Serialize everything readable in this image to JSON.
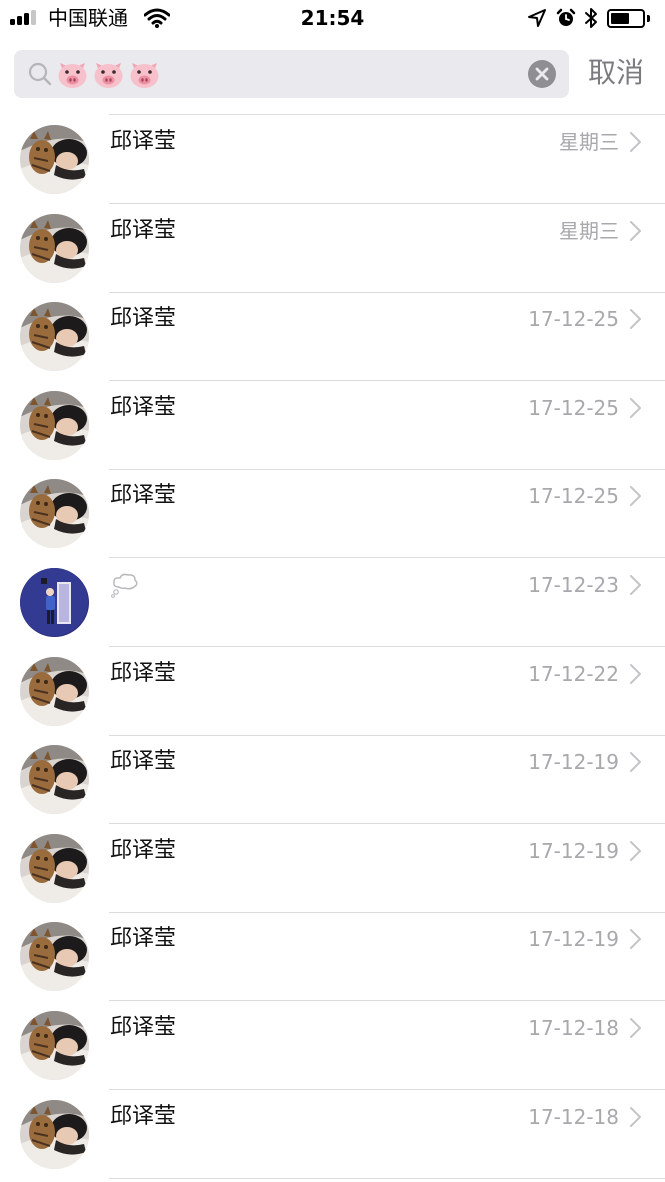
{
  "status_bar": {
    "carrier": "中国联通",
    "time": "21:54",
    "icons": [
      "signal-icon",
      "wifi-icon",
      "location-arrow-icon",
      "alarm-icon",
      "bluetooth-icon",
      "battery-icon"
    ]
  },
  "search": {
    "query_icons": [
      "pig-face-icon",
      "pig-face-icon",
      "pig-face-icon"
    ],
    "clear_icon": "clear-icon",
    "cancel_label": "取消"
  },
  "results": [
    {
      "name": "邱译莹",
      "date": "星期三",
      "avatar": "photo-avatar"
    },
    {
      "name": "邱译莹",
      "date": "星期三",
      "avatar": "photo-avatar"
    },
    {
      "name": "邱译莹",
      "date": "17-12-25",
      "avatar": "photo-avatar"
    },
    {
      "name": "邱译莹",
      "date": "17-12-25",
      "avatar": "photo-avatar"
    },
    {
      "name": "邱译莹",
      "date": "17-12-25",
      "avatar": "photo-avatar"
    },
    {
      "name": "",
      "name_icon": "thought-bubble-icon",
      "date": "17-12-23",
      "avatar": "illustration-avatar"
    },
    {
      "name": "邱译莹",
      "date": "17-12-22",
      "avatar": "photo-avatar"
    },
    {
      "name": "邱译莹",
      "date": "17-12-19",
      "avatar": "photo-avatar"
    },
    {
      "name": "邱译莹",
      "date": "17-12-19",
      "avatar": "photo-avatar"
    },
    {
      "name": "邱译莹",
      "date": "17-12-19",
      "avatar": "photo-avatar"
    },
    {
      "name": "邱译莹",
      "date": "17-12-18",
      "avatar": "photo-avatar"
    },
    {
      "name": "邱译莹",
      "date": "17-12-18",
      "avatar": "photo-avatar"
    }
  ],
  "colors": {
    "search_background": "#e9e9ee",
    "secondary_text": "#a8a8ad",
    "separator": "#dcdcdc"
  }
}
